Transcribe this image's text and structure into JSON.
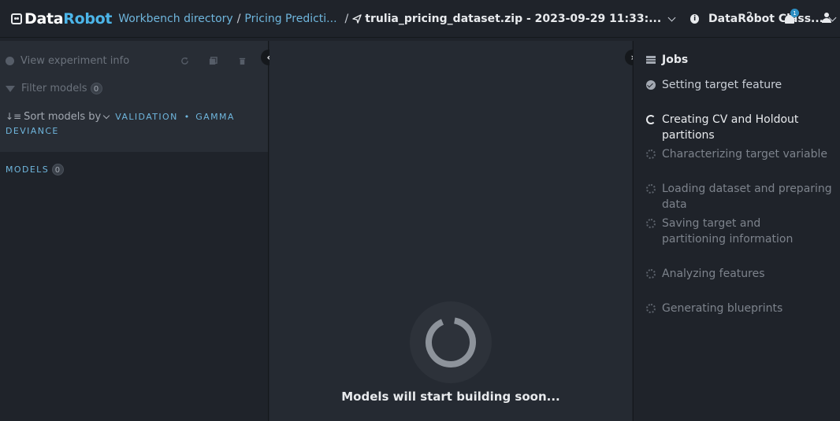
{
  "header": {
    "logo": {
      "part1": "Data",
      "part2": "Robot"
    },
    "breadcrumb_1": "Workbench directory",
    "breadcrumb_2": "Pricing Predicti...",
    "separator": "/",
    "dataset_name": "trulia_pricing_dataset.zip - 2023-09-29 11:33:...",
    "org_name": "DataRobot Class...",
    "help_label": "?",
    "notification_count": "1"
  },
  "left_panel": {
    "view_info_label": "View experiment info",
    "filter_label": "Filter models",
    "filter_count": "0",
    "sort_label": "Sort models by",
    "metric_part1": "VALIDATION",
    "metric_part2": "GAMMA",
    "metric_part3": "DEVIANCE",
    "models_label": "MODELS",
    "models_count": "0"
  },
  "center": {
    "status_text": "Models will start building soon..."
  },
  "right_panel": {
    "title": "Jobs",
    "jobs": [
      {
        "label": "Setting target feature",
        "status": "done"
      },
      {
        "label": "Creating CV and Holdout partitions",
        "status": "active"
      },
      {
        "label": "Characterizing target variable",
        "status": "pending"
      },
      {
        "label": "Loading dataset and preparing data",
        "status": "pending"
      },
      {
        "label": "Saving target and partitioning information",
        "status": "pending"
      },
      {
        "label": "Analyzing features",
        "status": "pending"
      },
      {
        "label": "Generating blueprints",
        "status": "pending"
      }
    ]
  },
  "colors": {
    "accent": "#6fb6dd",
    "brand_blue": "#4cb5e8",
    "background": "#1f232a"
  }
}
